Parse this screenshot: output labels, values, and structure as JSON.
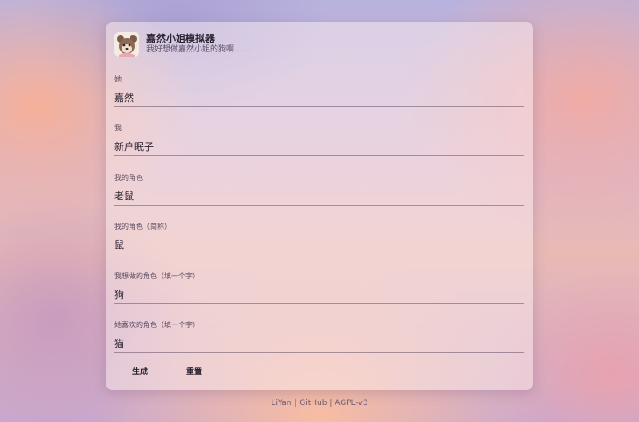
{
  "header": {
    "title": "嘉然小姐模拟器",
    "subtitle": "我好想做嘉然小姐的狗啊……",
    "avatar_icon": "bear-avatar-icon"
  },
  "fields": [
    {
      "label": "她",
      "value": "嘉然"
    },
    {
      "label": "我",
      "value": "新户眠子"
    },
    {
      "label": "我的角色",
      "value": "老鼠"
    },
    {
      "label": "我的角色（简称）",
      "value": "鼠"
    },
    {
      "label": "我想做的角色（填一个字）",
      "value": "狗"
    },
    {
      "label": "她喜欢的角色（填一个字）",
      "value": "猫"
    }
  ],
  "buttons": {
    "generate_label": "生成",
    "reset_label": "重置"
  },
  "footer": {
    "author": "LiYan",
    "separator": "|",
    "github": "GitHub",
    "license": "AGPL-v3"
  },
  "colors": {
    "text_primary": "#2b2230",
    "card_background": "rgba(255,244,244,0.45)"
  }
}
